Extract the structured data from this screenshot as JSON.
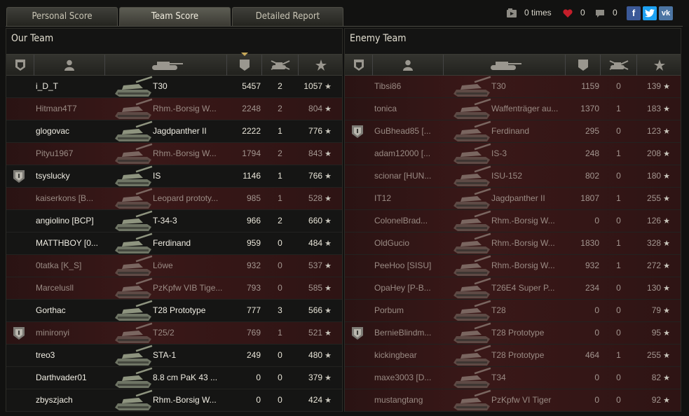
{
  "tabs": [
    {
      "label": "Personal Score",
      "active": false
    },
    {
      "label": "Team Score",
      "active": true
    },
    {
      "label": "Detailed Report",
      "active": false
    }
  ],
  "status": {
    "played_times": "0 times",
    "likes": "0",
    "comments": "0"
  },
  "social": [
    "facebook-icon",
    "twitter-icon",
    "vk-icon"
  ],
  "colors": {
    "dead_row": "#3a1818",
    "alive_row": "#151514",
    "accent": "#c7a95a"
  },
  "our_team": {
    "title": "Our Team",
    "rows": [
      {
        "name": "i_D_T",
        "vehicle": "T30",
        "damage": "5457",
        "kills": "2",
        "xp": "1057",
        "dead": false,
        "badge": false
      },
      {
        "name": "Hitman4T7",
        "vehicle": "Rhm.-Borsig W...",
        "damage": "2248",
        "kills": "2",
        "xp": "804",
        "dead": true,
        "badge": false
      },
      {
        "name": "glogovac",
        "vehicle": "Jagdpanther II",
        "damage": "2222",
        "kills": "1",
        "xp": "776",
        "dead": false,
        "badge": false
      },
      {
        "name": "Pityu1967",
        "vehicle": "Rhm.-Borsig W...",
        "damage": "1794",
        "kills": "2",
        "xp": "843",
        "dead": true,
        "badge": false
      },
      {
        "name": "tsyslucky",
        "vehicle": "IS",
        "damage": "1146",
        "kills": "1",
        "xp": "766",
        "dead": false,
        "badge": true
      },
      {
        "name": "kaiserkons [B...",
        "vehicle": "Leopard prototy...",
        "damage": "985",
        "kills": "1",
        "xp": "528",
        "dead": true,
        "badge": false
      },
      {
        "name": "angiolino [BCP]",
        "vehicle": "T-34-3",
        "damage": "966",
        "kills": "2",
        "xp": "660",
        "dead": false,
        "badge": false
      },
      {
        "name": "MATTHBOY [0...",
        "vehicle": "Ferdinand",
        "damage": "959",
        "kills": "0",
        "xp": "484",
        "dead": false,
        "badge": false
      },
      {
        "name": "0tatka [K_S]",
        "vehicle": "Löwe",
        "damage": "932",
        "kills": "0",
        "xp": "537",
        "dead": true,
        "badge": false
      },
      {
        "name": "Marcelusll",
        "vehicle": "PzKpfw VIB Tige...",
        "damage": "793",
        "kills": "0",
        "xp": "585",
        "dead": true,
        "badge": false
      },
      {
        "name": "Gorthac",
        "vehicle": "T28 Prototype",
        "damage": "777",
        "kills": "3",
        "xp": "566",
        "dead": false,
        "badge": false
      },
      {
        "name": "minironyi",
        "vehicle": "T25/2",
        "damage": "769",
        "kills": "1",
        "xp": "521",
        "dead": true,
        "badge": true
      },
      {
        "name": "treo3",
        "vehicle": "STA-1",
        "damage": "249",
        "kills": "0",
        "xp": "480",
        "dead": false,
        "badge": false
      },
      {
        "name": "Darthvader01",
        "vehicle": "8.8 cm PaK 43 ...",
        "damage": "0",
        "kills": "0",
        "xp": "379",
        "dead": false,
        "badge": false
      },
      {
        "name": "zbyszjach",
        "vehicle": "Rhm.-Borsig W...",
        "damage": "0",
        "kills": "0",
        "xp": "424",
        "dead": false,
        "badge": false
      }
    ]
  },
  "enemy_team": {
    "title": "Enemy Team",
    "rows": [
      {
        "name": "Tibsi86",
        "vehicle": "T30",
        "damage": "1159",
        "kills": "0",
        "xp": "139",
        "dead": true,
        "badge": false
      },
      {
        "name": "tonica",
        "vehicle": "Waffenträger au...",
        "damage": "1370",
        "kills": "1",
        "xp": "183",
        "dead": true,
        "badge": false
      },
      {
        "name": "GuBhead85 [...",
        "vehicle": "Ferdinand",
        "damage": "295",
        "kills": "0",
        "xp": "123",
        "dead": true,
        "badge": true
      },
      {
        "name": "adam12000 [...",
        "vehicle": "IS-3",
        "damage": "248",
        "kills": "1",
        "xp": "208",
        "dead": true,
        "badge": false
      },
      {
        "name": "scionar [HUN...",
        "vehicle": "ISU-152",
        "damage": "802",
        "kills": "0",
        "xp": "180",
        "dead": true,
        "badge": false
      },
      {
        "name": "IT12",
        "vehicle": "Jagdpanther II",
        "damage": "1807",
        "kills": "1",
        "xp": "255",
        "dead": true,
        "badge": false
      },
      {
        "name": "ColonelBrad...",
        "vehicle": "Rhm.-Borsig W...",
        "damage": "0",
        "kills": "0",
        "xp": "126",
        "dead": true,
        "badge": false
      },
      {
        "name": "OldGucio",
        "vehicle": "Rhm.-Borsig W...",
        "damage": "1830",
        "kills": "1",
        "xp": "328",
        "dead": true,
        "badge": false
      },
      {
        "name": "PeeHoo [SISU]",
        "vehicle": "Rhm.-Borsig W...",
        "damage": "932",
        "kills": "1",
        "xp": "272",
        "dead": true,
        "badge": false
      },
      {
        "name": "OpaHey [P-B...",
        "vehicle": "T26E4 Super P...",
        "damage": "234",
        "kills": "0",
        "xp": "130",
        "dead": true,
        "badge": false
      },
      {
        "name": "Porbum",
        "vehicle": "T28",
        "damage": "0",
        "kills": "0",
        "xp": "79",
        "dead": true,
        "badge": false
      },
      {
        "name": "BernieBlindm...",
        "vehicle": "T28 Prototype",
        "damage": "0",
        "kills": "0",
        "xp": "95",
        "dead": true,
        "badge": true
      },
      {
        "name": "kickingbear",
        "vehicle": "T28 Prototype",
        "damage": "464",
        "kills": "1",
        "xp": "255",
        "dead": true,
        "badge": false
      },
      {
        "name": "maxe3003 [D...",
        "vehicle": "T34",
        "damage": "0",
        "kills": "0",
        "xp": "82",
        "dead": true,
        "badge": false
      },
      {
        "name": "mustangtang",
        "vehicle": "PzKpfw VI Tiger",
        "damage": "0",
        "kills": "0",
        "xp": "92",
        "dead": true,
        "badge": false
      }
    ]
  },
  "column_icons": [
    "badge-column-icon",
    "player-column-icon",
    "vehicle-column-icon",
    "damage-column-icon",
    "kills-column-icon",
    "xp-column-icon"
  ]
}
